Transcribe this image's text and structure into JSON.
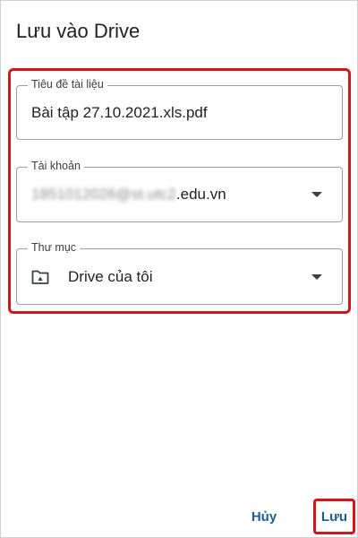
{
  "dialog": {
    "title": "Lưu vào Drive"
  },
  "form": {
    "document_title": {
      "label": "Tiêu đề tài liệu",
      "value": "Bài tập 27.10.2021.xls.pdf"
    },
    "account": {
      "label": "Tài khoản",
      "value_obscured": "1851012026@st.utc2",
      "value_suffix": ".edu.vn"
    },
    "folder": {
      "label": "Thư mục",
      "value": "Drive của tôi",
      "icon": "drive-folder-icon"
    }
  },
  "actions": {
    "cancel_label": "Hủy",
    "save_label": "Lưu"
  },
  "colors": {
    "highlight": "#d0171b",
    "button_text": "#1a5f8c"
  }
}
